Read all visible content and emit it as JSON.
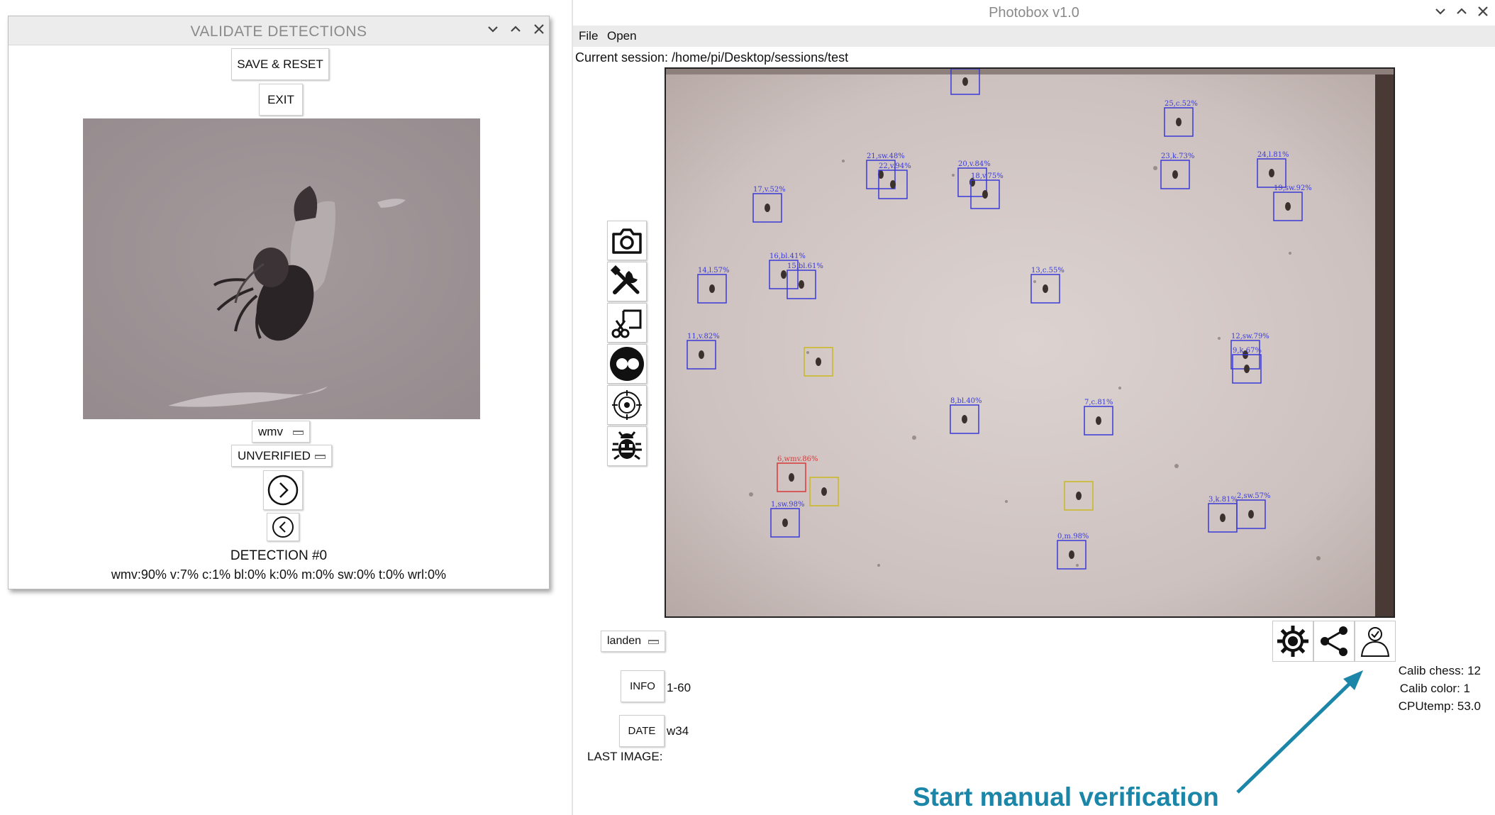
{
  "validate_window": {
    "title": "VALIDATE DETECTIONS",
    "save_reset_label": "SAVE & RESET",
    "exit_label": "EXIT",
    "class_select_value": "wmv",
    "status_select_value": "UNVERIFIED",
    "detection_title": "DETECTION #0",
    "scores_line": "wmv:90% v:7% c:1% bl:0% k:0% m:0% sw:0% t:0% wrl:0%"
  },
  "photobox": {
    "title": "Photobox v1.0",
    "menu": [
      "File",
      "Open"
    ],
    "current_session": "Current session: /home/pi/Desktop/sessions/test",
    "location_select_value": "landen",
    "info_label": "INFO",
    "info_value": "1-60",
    "date_label": "DATE",
    "date_value": "w34",
    "last_image_label": "LAST IMAGE:",
    "calib_chess": "Calib chess: 12",
    "calib_color": "Calib color: 1",
    "cpu_temp": "CPUtemp: 53.0",
    "tools": [
      "camera-icon",
      "tools-icon",
      "crop-icon",
      "flickr-icon",
      "target-icon",
      "bug-icon"
    ],
    "bottom_tools": [
      "gear-icon",
      "share-icon",
      "verify-user-icon"
    ]
  },
  "detections": [
    {
      "label": "25,c.52%",
      "color": "#3a3ad8"
    },
    {
      "label": "23,k.73%",
      "color": "#3a3ad8"
    },
    {
      "label": "24,l.81%",
      "color": "#3a3ad8"
    },
    {
      "label": "19,sw.92%",
      "color": "#3a3ad8"
    },
    {
      "label": "21,sw.48%",
      "color": "#3a3ad8"
    },
    {
      "label": "22,v.94%",
      "color": "#3a3ad8"
    },
    {
      "label": "20,v.84%",
      "color": "#3a3ad8"
    },
    {
      "label": "18,v.75%",
      "color": "#3a3ad8"
    },
    {
      "label": "17,v.52%",
      "color": "#3a3ad8"
    },
    {
      "label": "16,bl.41%",
      "color": "#3a3ad8"
    },
    {
      "label": "15,bl.61%",
      "color": "#3a3ad8"
    },
    {
      "label": "14,l.57%",
      "color": "#3a3ad8"
    },
    {
      "label": "13,c.55%",
      "color": "#3a3ad8"
    },
    {
      "label": "12,sw.79%",
      "color": "#3a3ad8"
    },
    {
      "label": "9,k.67%",
      "color": "#3a3ad8"
    },
    {
      "label": "11,v.82%",
      "color": "#3a3ad8"
    },
    {
      "label": "",
      "color": "#c9b820"
    },
    {
      "label": "8,bl.40%",
      "color": "#3a3ad8"
    },
    {
      "label": "7,c.81%",
      "color": "#3a3ad8"
    },
    {
      "label": "6,wmv.86%",
      "color": "#d83a3a"
    },
    {
      "label": "",
      "color": "#c9b820"
    },
    {
      "label": "",
      "color": "#c9b820"
    },
    {
      "label": "1,sw.98%",
      "color": "#3a3ad8"
    },
    {
      "label": "3,k.81%",
      "color": "#3a3ad8"
    },
    {
      "label": "2,sw.57%",
      "color": "#3a3ad8"
    },
    {
      "label": "0,m.98%",
      "color": "#3a3ad8"
    },
    {
      "label": "",
      "color": "#3a3ad8"
    }
  ],
  "annotation": {
    "text": "Start manual verification",
    "color": "#1b86a8"
  }
}
